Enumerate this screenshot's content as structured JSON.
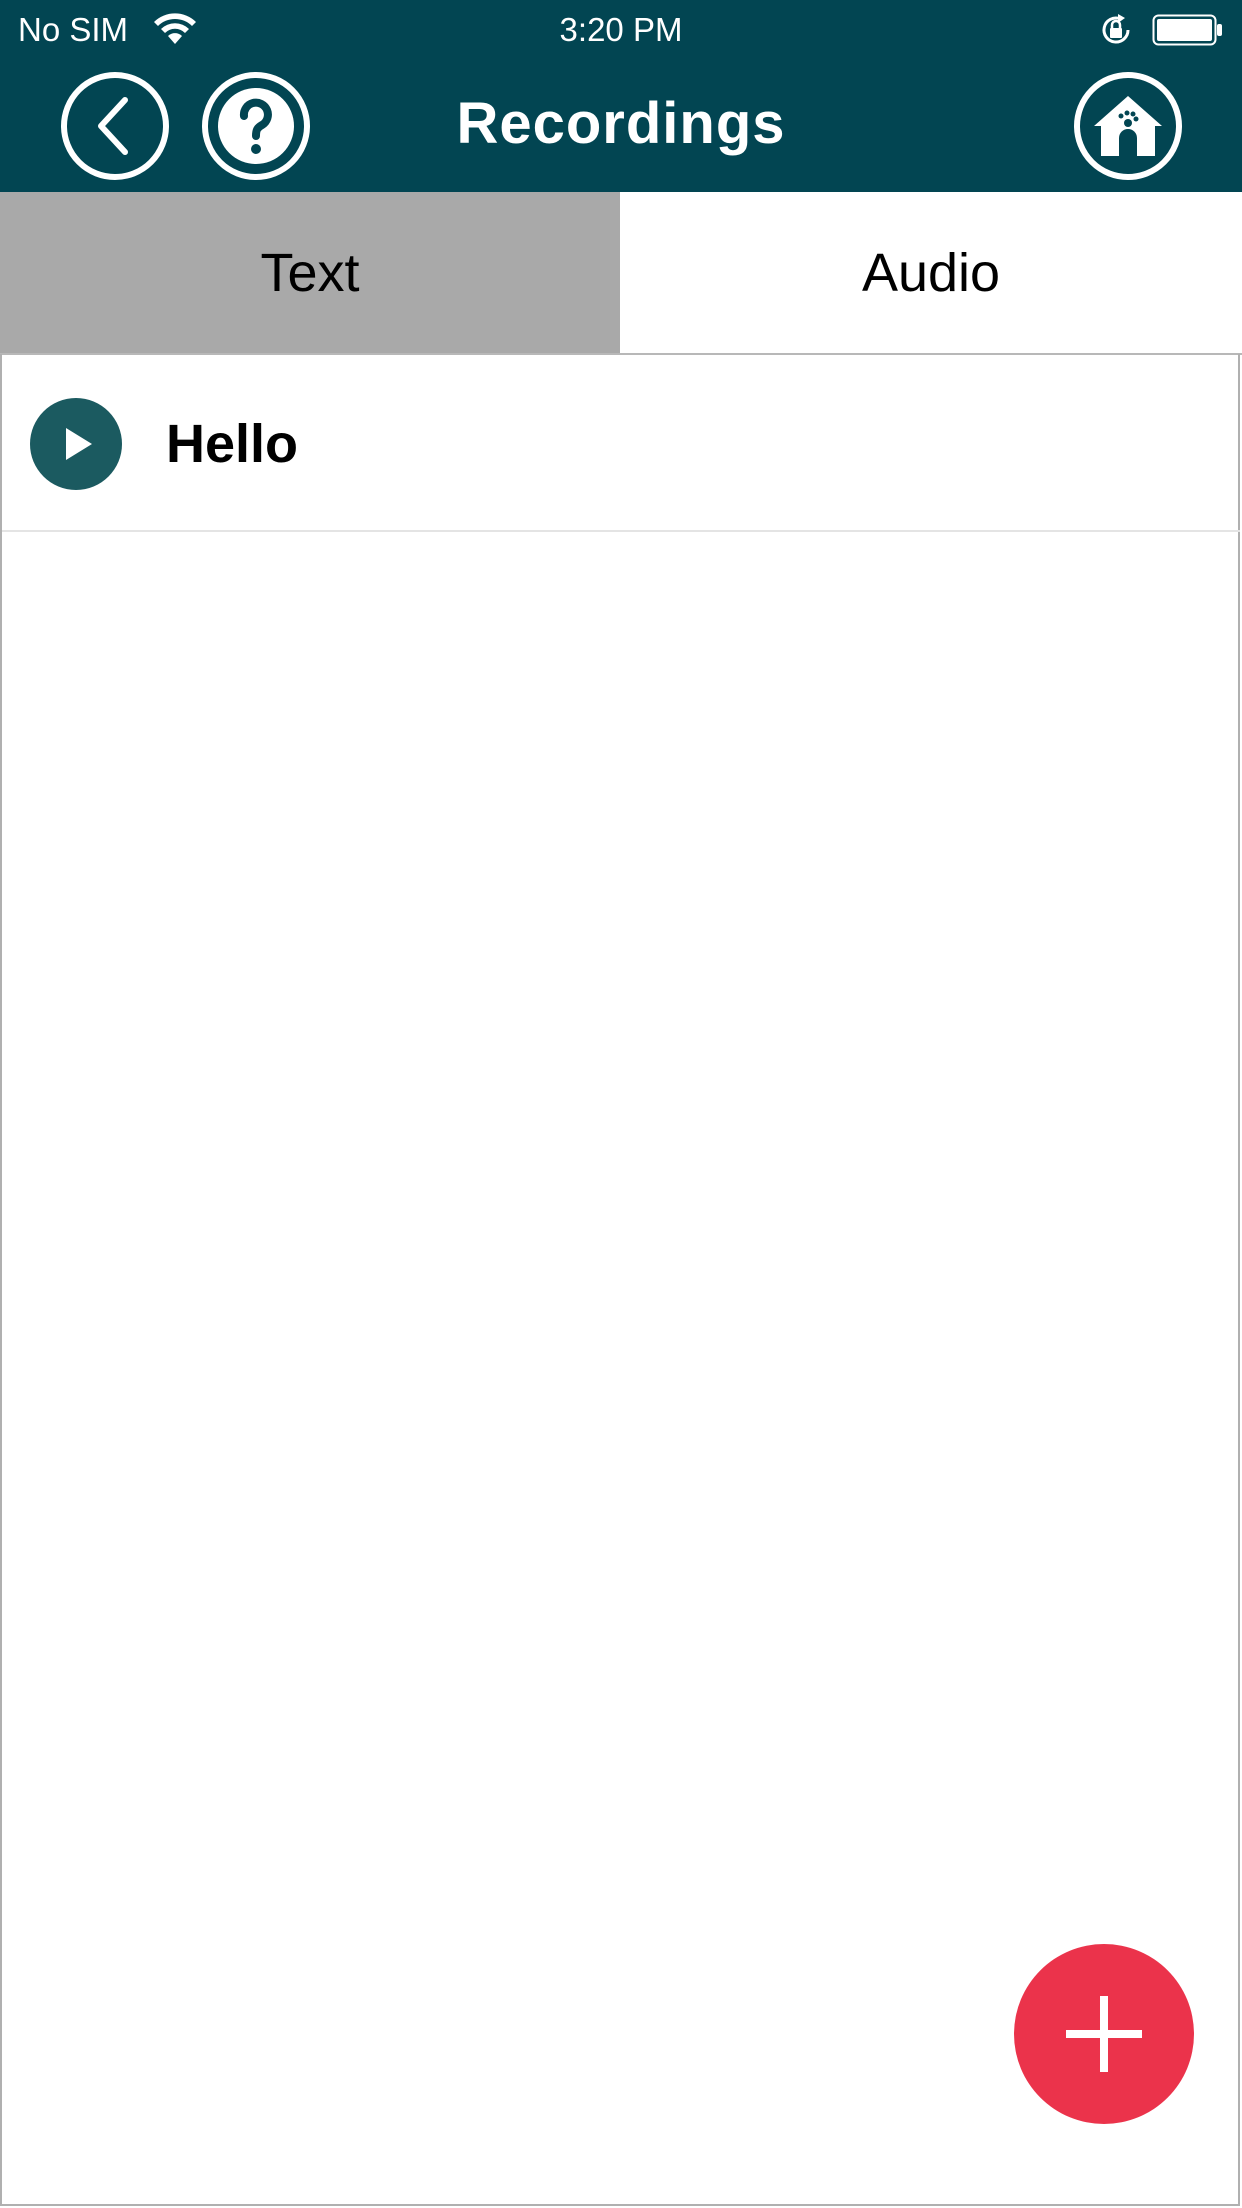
{
  "status_bar": {
    "carrier": "No SIM",
    "time": "3:20 PM",
    "wifi_icon": "wifi-icon",
    "orientation_lock_icon": "orientation-lock-icon",
    "battery_icon": "battery-icon"
  },
  "header": {
    "title": "Recordings",
    "back_icon": "chevron-left-icon",
    "help_icon": "question-mark-icon",
    "home_icon": "home-icon",
    "background_color": "#024552"
  },
  "tabs": [
    {
      "label": "Text",
      "selected": false
    },
    {
      "label": "Audio",
      "selected": true
    }
  ],
  "recordings": [
    {
      "label": "Hello",
      "icon": "play-icon"
    }
  ],
  "fab": {
    "icon": "plus-icon",
    "color": "#eb334b"
  }
}
